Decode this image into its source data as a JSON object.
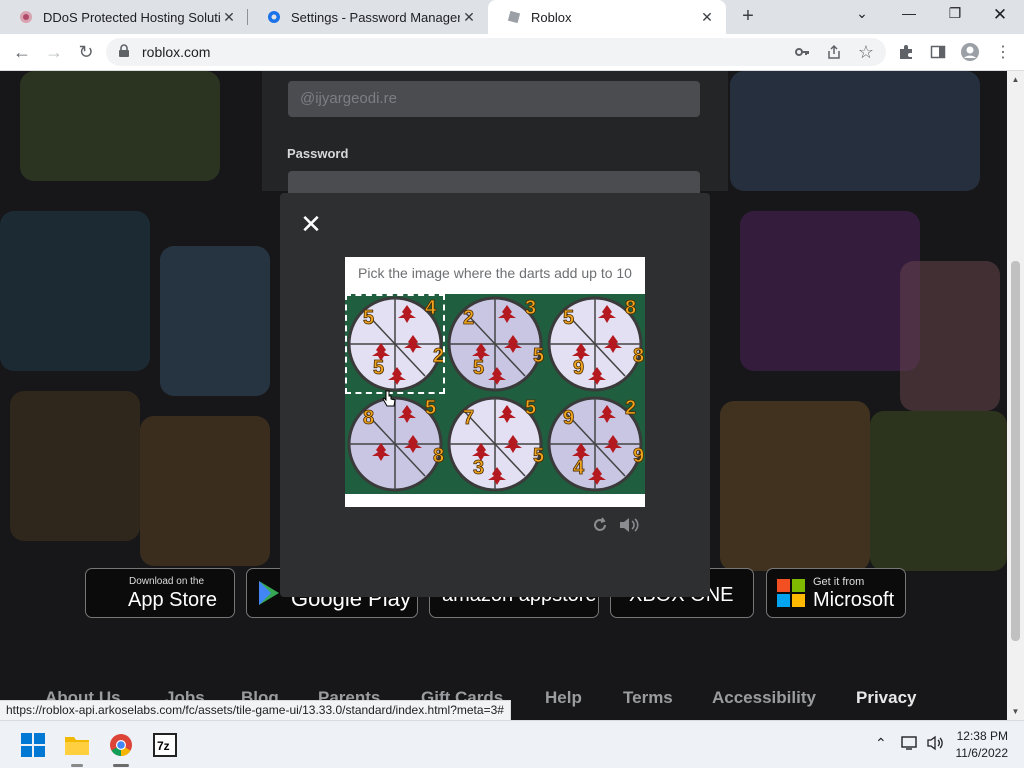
{
  "browser": {
    "tabs": [
      {
        "title": "DDoS Protected Hosting Solutio",
        "active": false,
        "icon": "ddos-site-favicon"
      },
      {
        "title": "Settings - Password Manager",
        "active": false,
        "icon": "settings-gear-favicon"
      },
      {
        "title": "Roblox",
        "active": true,
        "icon": "roblox-favicon"
      }
    ],
    "new_tab_symbol": "+",
    "url": "roblox.com",
    "window_controls": [
      "chevron-down-icon",
      "minimize-icon",
      "restore-icon",
      "close-icon"
    ]
  },
  "page": {
    "login": {
      "email_placeholder": "@ijyargeodi.re",
      "password_label": "Password"
    },
    "badges": [
      {
        "small": "Download on the",
        "big": "App Store"
      },
      {
        "small": "",
        "big": "Google Play"
      },
      {
        "small": "",
        "big": "amazon appstore"
      },
      {
        "small": "",
        "big": "XBOX ONE"
      },
      {
        "small": "Get it from",
        "big": "Microsoft"
      }
    ],
    "footer_links": [
      "About Us",
      "Jobs",
      "Blog",
      "Parents",
      "Gift Cards",
      "Help",
      "Terms",
      "Accessibility",
      "Privacy"
    ]
  },
  "modal": {
    "close_symbol": "✕",
    "prompt": "Pick the image where the darts add up to 10",
    "tiles": [
      {
        "numbers": [
          "5",
          "4",
          "2",
          "5"
        ],
        "selected": true
      },
      {
        "numbers": [
          "2",
          "3",
          "5",
          "5"
        ],
        "selected": false
      },
      {
        "numbers": [
          "5",
          "8",
          "8",
          "9"
        ],
        "selected": false
      },
      {
        "numbers": [
          "8",
          "5",
          "8"
        ],
        "selected": false
      },
      {
        "numbers": [
          "7",
          "5",
          "5",
          "3"
        ],
        "selected": false
      },
      {
        "numbers": [
          "9",
          "2",
          "9",
          "4"
        ],
        "selected": false
      }
    ],
    "icons": [
      "reload-icon",
      "audio-icon"
    ]
  },
  "status_url": "https://roblox-api.arkoselabs.com/fc/assets/tile-game-ui/13.33.0/standard/index.html?meta=3#",
  "taskbar": {
    "apps": [
      "windows-start-icon",
      "file-explorer-icon",
      "chrome-icon",
      "7zip-icon"
    ],
    "time": "12:38 PM",
    "date": "11/6/2022"
  },
  "colors": {
    "modal_bg": "#2d2f31",
    "grid_green": "#1f5e3e",
    "dart_red": "#b3191e",
    "number_gold": "#f0a51e"
  }
}
